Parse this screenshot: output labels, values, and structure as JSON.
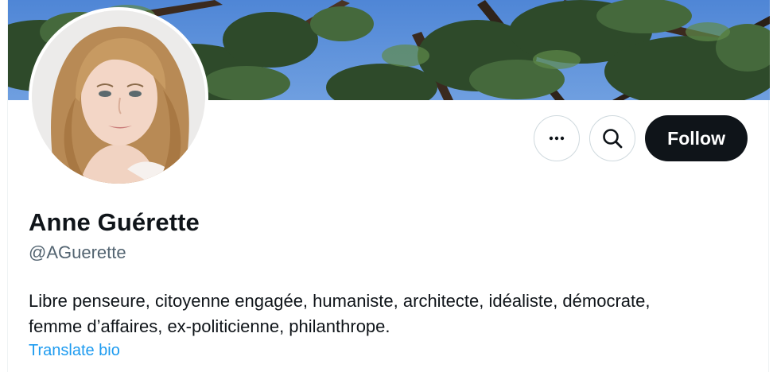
{
  "profile": {
    "display_name": "Anne Guérette",
    "handle": "@AGuerette",
    "bio_lines": [
      "Libre penseure, citoyenne engagée, humaniste, architecte, idéaliste, démocrate,",
      "femme d’affaires, ex-politicienne, philanthrope."
    ],
    "translate_label": "Translate bio"
  },
  "actions": {
    "more_icon": "more-horizontal-icon",
    "search_icon": "search-icon",
    "follow_label": "Follow"
  },
  "colors": {
    "text_primary": "#0f1419",
    "text_secondary": "#536471",
    "link": "#1d9bf0",
    "follow_bg": "#0f1419",
    "border": "#cfd9de"
  }
}
